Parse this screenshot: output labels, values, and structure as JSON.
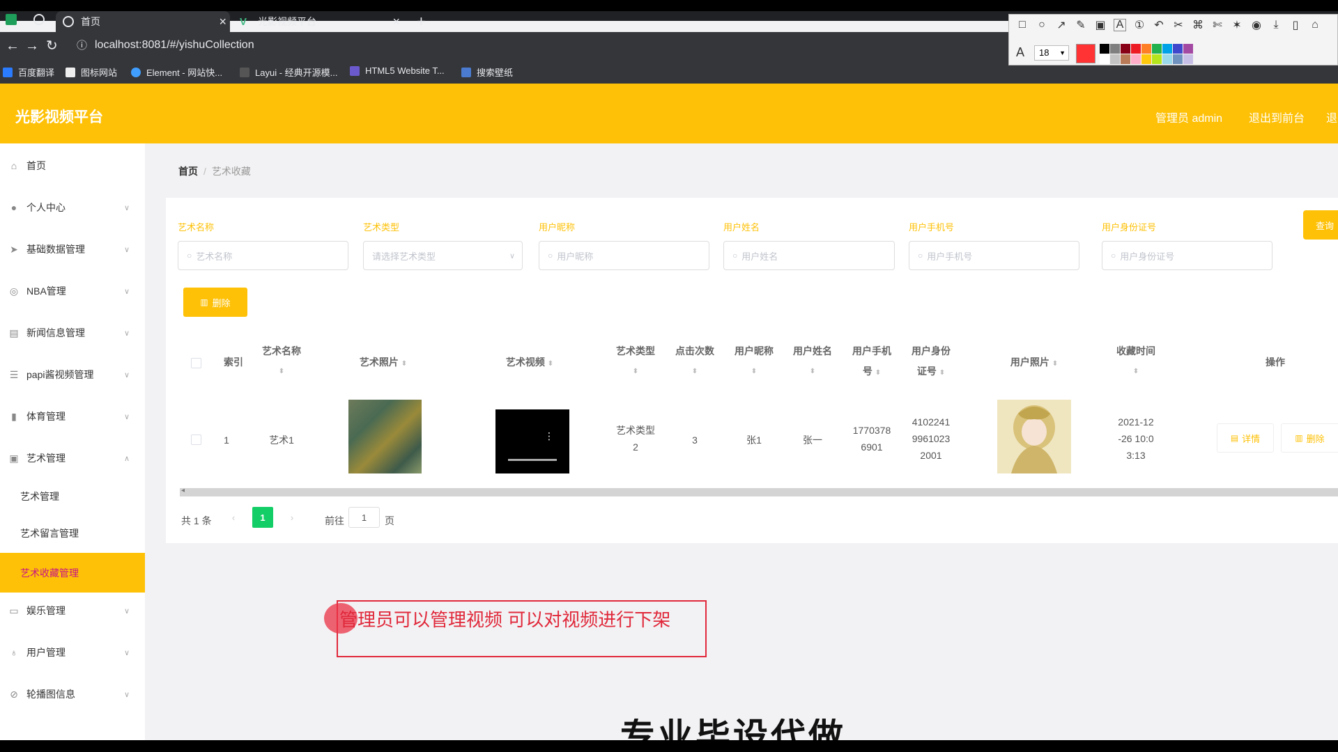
{
  "browser": {
    "tabs": [
      {
        "label": "首页"
      },
      {
        "label": "光影视频平台"
      }
    ],
    "url": "localhost:8081/#/yishuCollection",
    "bookmarks": [
      "百度翻译",
      "图标网站",
      "Element - 网站快...",
      "Layui - 经典开源模...",
      "HTML5 Website T...",
      "搜索壁纸"
    ]
  },
  "annotation_toolbar": {
    "font_size": "18",
    "font_icon": "A",
    "swatch_colors": [
      "#000000",
      "#7f7f7f",
      "#880015",
      "#ed1c24",
      "#ff7f27",
      "#22b14c",
      "#00a2e8",
      "#3f48cc",
      "#a349a4",
      "#ffffff",
      "#c3c3c3",
      "#b97a57",
      "#ffaec9",
      "#ffc90e",
      "#b5e61d",
      "#99d9ea",
      "#7092be",
      "#c8bfe7"
    ]
  },
  "app": {
    "title": "光影视频平台",
    "header_links": [
      "管理员 admin",
      "退出到前台",
      "退"
    ]
  },
  "sidebar": {
    "items": [
      {
        "label": "首页",
        "icon": "home-icon"
      },
      {
        "label": "个人中心",
        "icon": "user-icon"
      },
      {
        "label": "基础数据管理",
        "icon": "send-icon"
      },
      {
        "label": "NBA管理",
        "icon": "circle-icon"
      },
      {
        "label": "新闻信息管理",
        "icon": "message-icon"
      },
      {
        "label": "papi酱视频管理",
        "icon": "list-icon"
      },
      {
        "label": "体育管理",
        "icon": "chart-icon"
      },
      {
        "label": "艺术管理",
        "icon": "clipboard-icon"
      }
    ],
    "sub_items": [
      "艺术管理",
      "艺术留言管理",
      "艺术收藏管理"
    ],
    "items_after": [
      {
        "label": "娱乐管理",
        "icon": "chat-icon"
      },
      {
        "label": "用户管理",
        "icon": "mic-icon"
      },
      {
        "label": "轮播图信息",
        "icon": "compass-icon"
      }
    ]
  },
  "breadcrumb": {
    "home": "首页",
    "current": "艺术收藏"
  },
  "filters": [
    {
      "label": "艺术名称",
      "placeholder": "艺术名称"
    },
    {
      "label": "艺术类型",
      "placeholder": "请选择艺术类型"
    },
    {
      "label": "用户昵称",
      "placeholder": "用户昵称"
    },
    {
      "label": "用户姓名",
      "placeholder": "用户姓名"
    },
    {
      "label": "用户手机号",
      "placeholder": "用户手机号"
    },
    {
      "label": "用户身份证号",
      "placeholder": "用户身份证号"
    }
  ],
  "buttons": {
    "query": "查询",
    "delete": "删除",
    "detail": "详情",
    "row_delete": "删除"
  },
  "table": {
    "headers": {
      "index": "索引",
      "art_name": "艺术名称",
      "art_photo": "艺术照片",
      "art_video": "艺术视频",
      "art_type": "艺术类型",
      "clicks": "点击次数",
      "nickname": "用户昵称",
      "username": "用户姓名",
      "phone_1": "用户手机",
      "phone_2": "号",
      "idcard_1": "用户身份",
      "idcard_2": "证号",
      "user_photo": "用户照片",
      "time": "收藏时间",
      "ops": "操作"
    },
    "rows": [
      {
        "index": "1",
        "art_name": "艺术1",
        "art_type_1": "艺术类型",
        "art_type_2": "2",
        "clicks": "3",
        "nickname": "张1",
        "username": "张一",
        "phone_1": "1770378",
        "phone_2": "6901",
        "idcard_1": "4102241",
        "idcard_2": "9961023",
        "idcard_3": "2001",
        "time_1": "2021-12",
        "time_2": "-26 10:0",
        "time_3": "3:13"
      }
    ]
  },
  "pagination": {
    "total": "共 1 条",
    "current_page": "1",
    "goto_label": "前往",
    "goto_value": "1",
    "page_unit": "页"
  },
  "overlay_note": "管理员可以管理视频 可以对视频进行下架",
  "overlay_big_text": "专业毕设代做"
}
